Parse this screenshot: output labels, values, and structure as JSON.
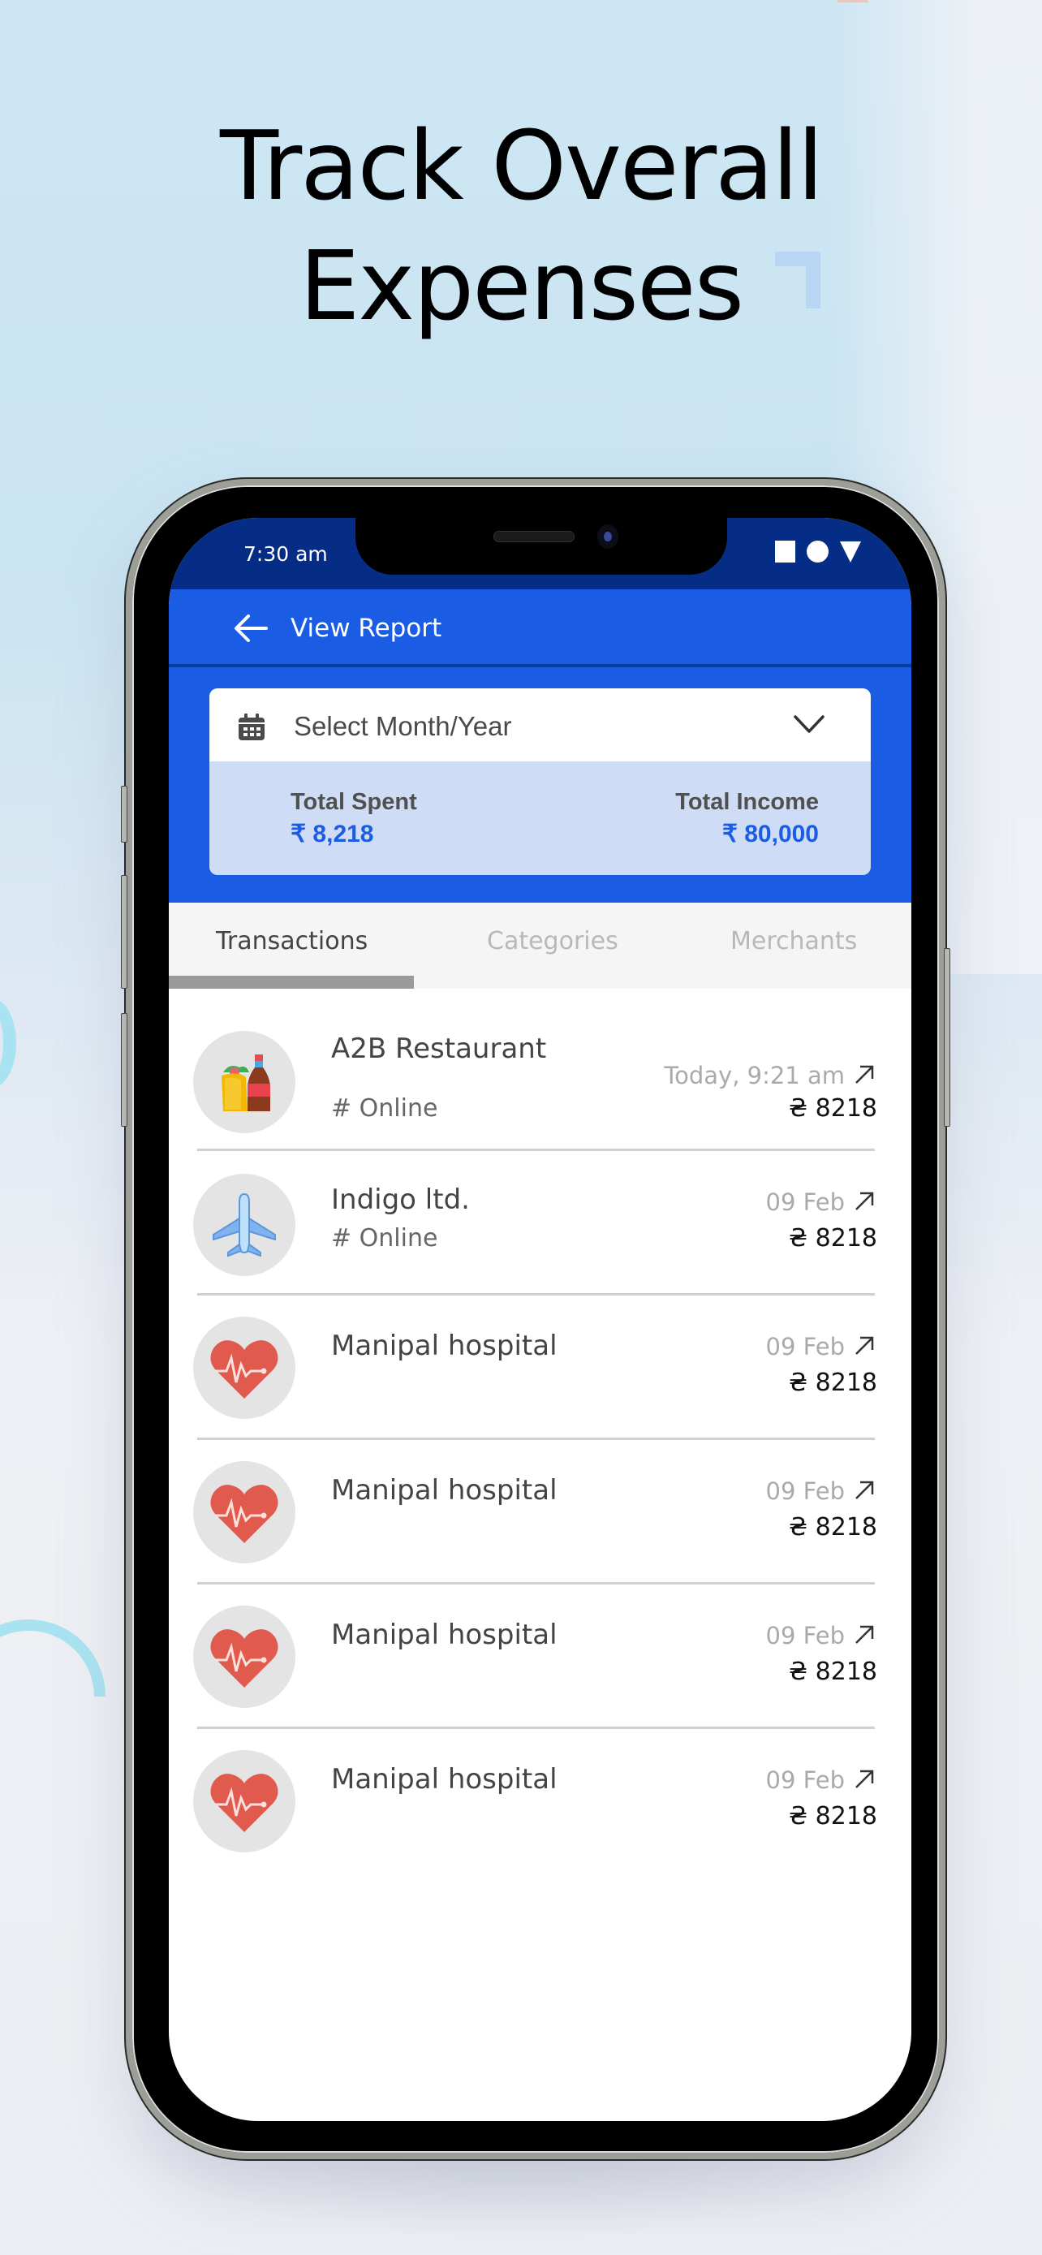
{
  "headline": {
    "line1": "Track Overall",
    "line2": "Expenses"
  },
  "status_bar": {
    "time": "7:30 am",
    "icons": [
      "square-icon",
      "circle-icon",
      "triangle-icon"
    ]
  },
  "app_bar": {
    "back_icon": "arrow-left-icon",
    "title": "View Report"
  },
  "month_selector": {
    "icon": "calendar-icon",
    "placeholder": "Select Month/Year",
    "dropdown_icon": "chevron-down-icon"
  },
  "totals": {
    "spent_label": "Total Spent",
    "spent_value": "₹ 8,218",
    "income_label": "Total Income",
    "income_value": "₹ 80,000"
  },
  "tabs": [
    {
      "label": "Transactions",
      "active": true
    },
    {
      "label": "Categories",
      "active": false
    },
    {
      "label": "Merchants",
      "active": false
    }
  ],
  "transactions": [
    {
      "icon": "food-drink-icon",
      "name": "A2B Restaurant",
      "tag": "# Online",
      "date": "Today, 9:21 am",
      "amount": "₴ 8218",
      "direction_icon": "arrow-up-right-icon"
    },
    {
      "icon": "airplane-icon",
      "name": "Indigo ltd.",
      "tag": "# Online",
      "date": "09 Feb",
      "amount": "₴ 8218",
      "direction_icon": "arrow-up-right-icon"
    },
    {
      "icon": "heart-pulse-icon",
      "name": "Manipal hospital",
      "tag": "",
      "date": "09 Feb",
      "amount": "₴ 8218",
      "direction_icon": "arrow-up-right-icon"
    },
    {
      "icon": "heart-pulse-icon",
      "name": "Manipal hospital",
      "tag": "",
      "date": "09 Feb",
      "amount": "₴ 8218",
      "direction_icon": "arrow-up-right-icon"
    },
    {
      "icon": "heart-pulse-icon",
      "name": "Manipal hospital",
      "tag": "",
      "date": "09 Feb",
      "amount": "₴ 8218",
      "direction_icon": "arrow-up-right-icon"
    },
    {
      "icon": "heart-pulse-icon",
      "name": "Manipal hospital",
      "tag": "",
      "date": "09 Feb",
      "amount": "₴ 8218",
      "direction_icon": "arrow-up-right-icon"
    }
  ],
  "colors": {
    "primary": "#1a5ce3",
    "status_bar": "#062d86",
    "totals_bg": "#cfdcf6",
    "heart_red": "#e05a4e"
  }
}
